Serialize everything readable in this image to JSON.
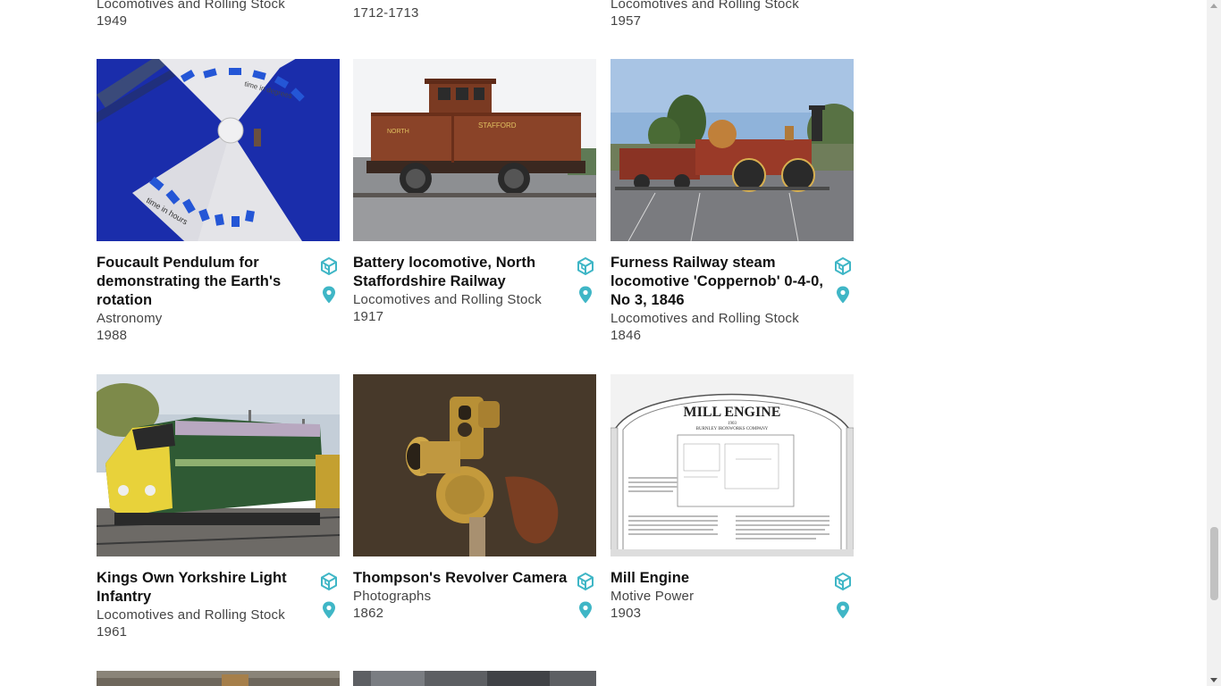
{
  "colors": {
    "accent": "#3fb6c6",
    "title": "#111111",
    "meta": "#444444"
  },
  "top_row": [
    {
      "category": "Locomotives and Rolling Stock",
      "year": "1949"
    },
    {
      "category": "",
      "year": "1712-1713"
    },
    {
      "category": "Locomotives and Rolling Stock",
      "year": "1957"
    }
  ],
  "cards": [
    {
      "title": "Foucault Pendulum for demonstrating the Earth's rotation",
      "category": "Astronomy",
      "year": "1988",
      "image": "pendulum",
      "dial_text_top": "time in degrees",
      "dial_text_bottom": "time in hours"
    },
    {
      "title": "Battery locomotive, North Staffordshire Railway",
      "category": "Locomotives and Rolling Stock",
      "year": "1917",
      "image": "battery-locomotive",
      "loco_text_left": "NORTH",
      "loco_text_right": "STAFFORD"
    },
    {
      "title": "Furness Railway steam locomotive 'Coppernob' 0-4-0, No 3, 1846",
      "category": "Locomotives and Rolling Stock",
      "year": "1846",
      "image": "coppernob"
    },
    {
      "title": "Kings Own Yorkshire Light Infantry",
      "category": "Locomotives and Rolling Stock",
      "year": "1961",
      "image": "deltic"
    },
    {
      "title": "Thompson's Revolver Camera",
      "category": "Photographs",
      "year": "1862",
      "image": "revolver-camera"
    },
    {
      "title": "Mill Engine",
      "category": "Motive Power",
      "year": "1903",
      "image": "mill-engine",
      "sign_title": "MILL ENGINE",
      "sign_year": "1903",
      "sign_subtitle": "BURNLEY IRONWORKS COMPANY"
    }
  ],
  "icons": {
    "view3d": "cube-3d-icon",
    "location": "location-pin-icon"
  }
}
